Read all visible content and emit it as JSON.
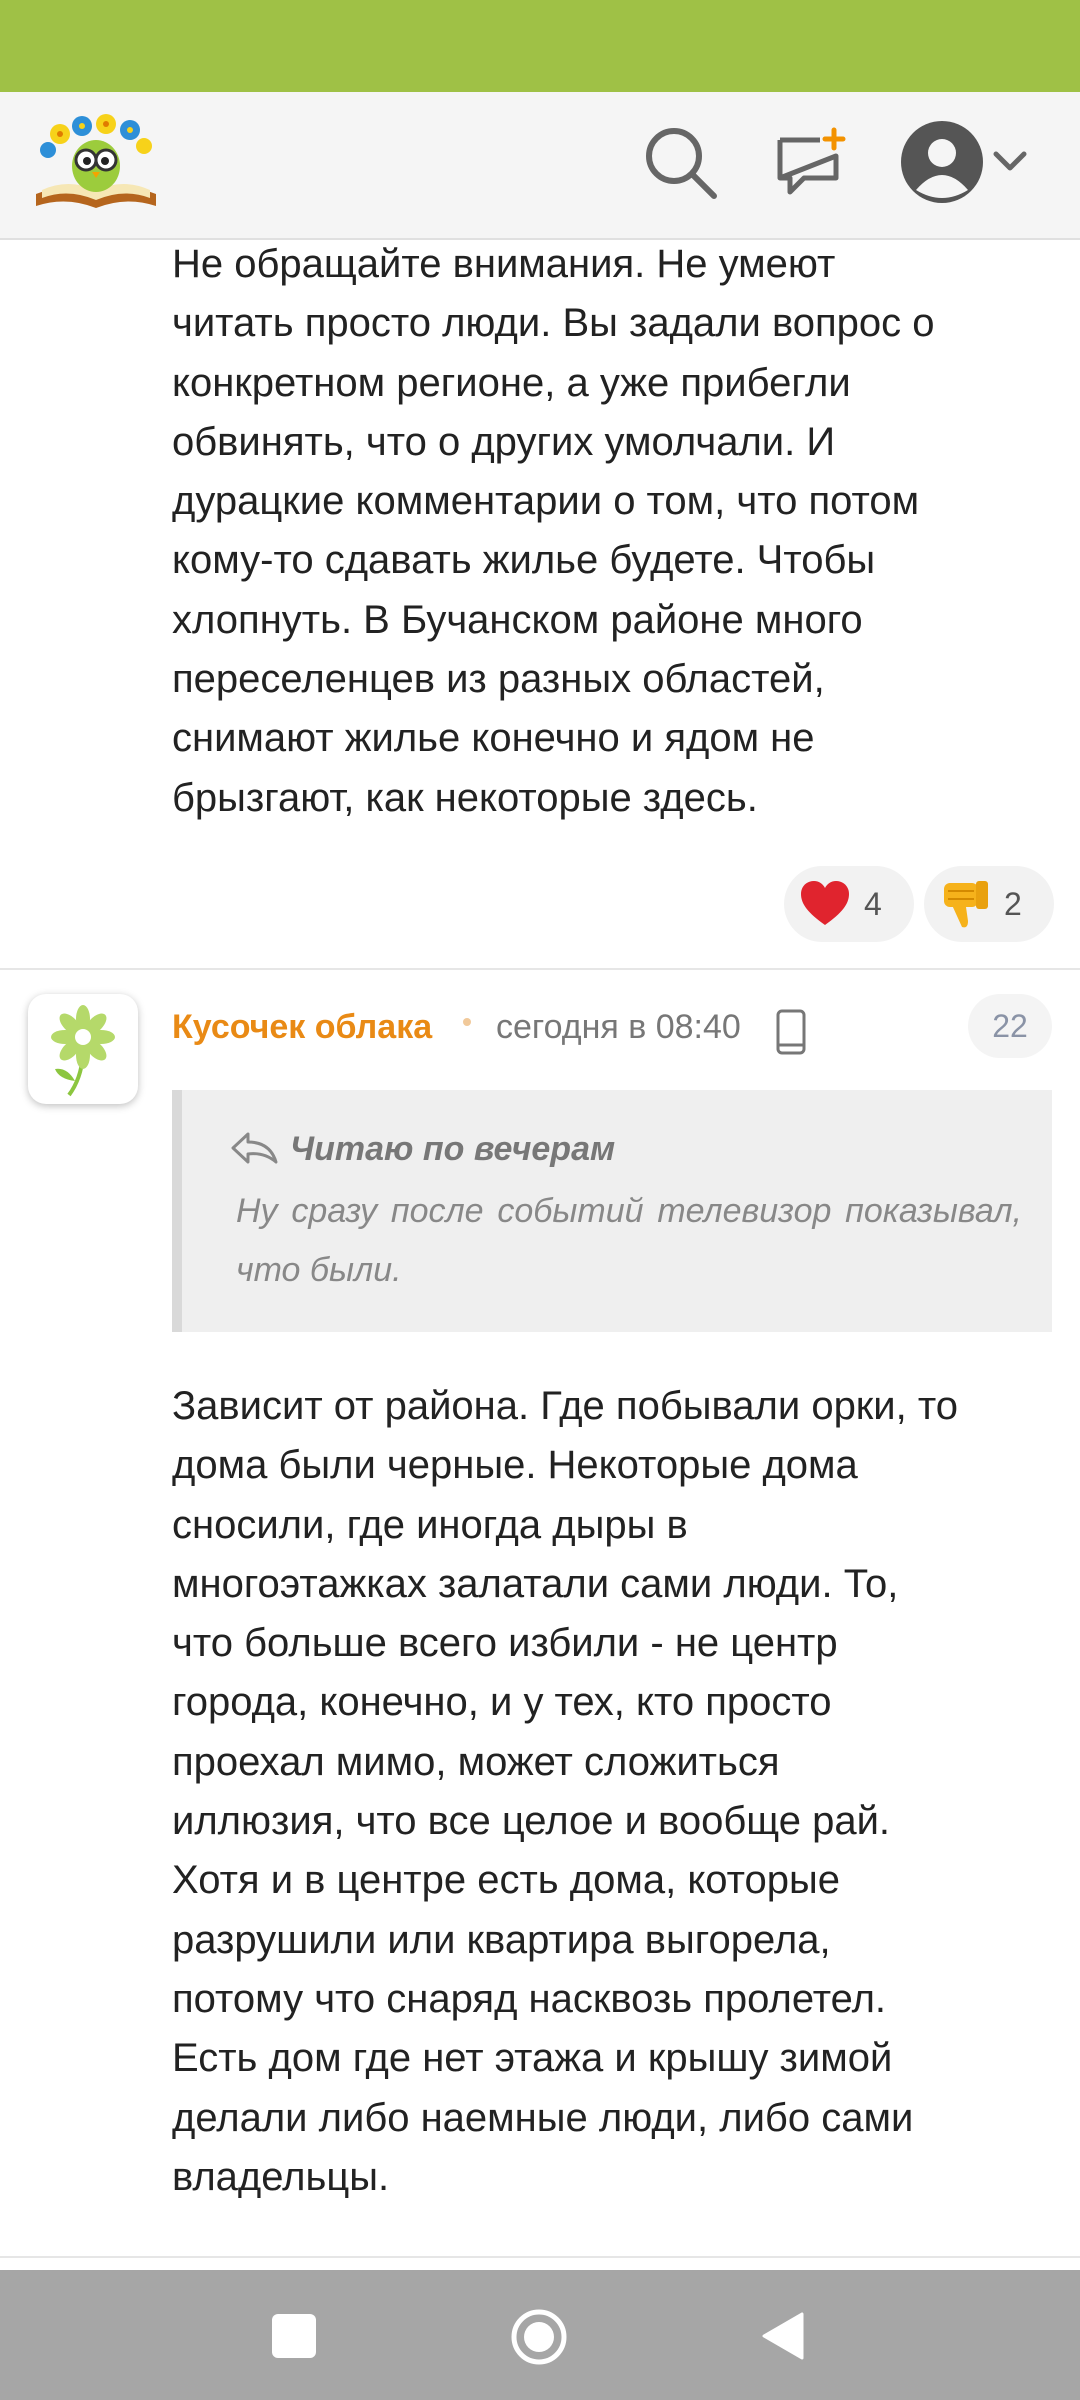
{
  "header": {
    "logo_icon": "book-owl-flowers-logo",
    "search_icon": "search-icon",
    "new_post_icon": "new-post-plus-icon",
    "avatar_icon": "user-avatar-icon",
    "chevron_icon": "chevron-down-icon"
  },
  "comments": [
    {
      "lines": [
        "Не обращайте внимания. Не умеют",
        "читать просто люди. Вы задали вопрос о",
        "конкретном регионе, а уже прибегли",
        "обвинять, что о других умолчали. И",
        "дурацкие комментарии о том, что потом",
        "кому-то сдавать жилье будете. Чтобы",
        "хлопнуть. В Бучанском районе много",
        "переселенцев из разных областей,",
        "снимают жилье конечно и ядом не",
        "брызгают, как некоторые здесь."
      ],
      "reactions": {
        "heart_count": "4",
        "dislike_count": "2"
      }
    },
    {
      "author": "Кусочек облака",
      "time": "сегодня в 08:40",
      "number": "22",
      "quote": {
        "author": "Читаю по вечерам",
        "text": "Ну сразу после событий телевизор показывал, что были."
      },
      "lines": [
        "Зависит от района. Где побывали орки, то",
        "дома были черные. Некоторые дома",
        "сносили, где иногда дыры в",
        "многоэтажках залатали сами люди. То,",
        "что больше всего избили - не центр",
        "города, конечно, и у тех, кто просто",
        "проехал мимо, может сложиться",
        "иллюзия, что все целое и вообще рай.",
        "Хотя и в центре есть дома, которые",
        "разрушили или квартира выгорела,",
        "потому что снаряд насквозь пролетел.",
        "Есть дом где нет этажа и крышу зимой",
        "делали либо наемные люди, либо сами",
        "владельцы."
      ]
    }
  ],
  "colors": {
    "status_bar": "#9fc146",
    "author_name": "#e98a15",
    "nav_bar": "#a6a6a6"
  }
}
